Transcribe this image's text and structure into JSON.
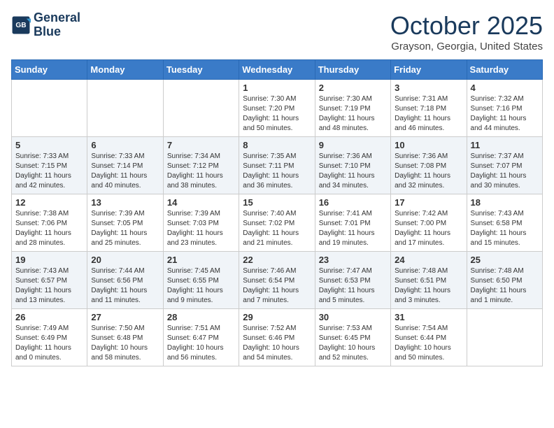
{
  "header": {
    "logo_line1": "General",
    "logo_line2": "Blue",
    "month": "October 2025",
    "location": "Grayson, Georgia, United States"
  },
  "weekdays": [
    "Sunday",
    "Monday",
    "Tuesday",
    "Wednesday",
    "Thursday",
    "Friday",
    "Saturday"
  ],
  "weeks": [
    [
      {
        "day": "",
        "info": ""
      },
      {
        "day": "",
        "info": ""
      },
      {
        "day": "",
        "info": ""
      },
      {
        "day": "1",
        "info": "Sunrise: 7:30 AM\nSunset: 7:20 PM\nDaylight: 11 hours\nand 50 minutes."
      },
      {
        "day": "2",
        "info": "Sunrise: 7:30 AM\nSunset: 7:19 PM\nDaylight: 11 hours\nand 48 minutes."
      },
      {
        "day": "3",
        "info": "Sunrise: 7:31 AM\nSunset: 7:18 PM\nDaylight: 11 hours\nand 46 minutes."
      },
      {
        "day": "4",
        "info": "Sunrise: 7:32 AM\nSunset: 7:16 PM\nDaylight: 11 hours\nand 44 minutes."
      }
    ],
    [
      {
        "day": "5",
        "info": "Sunrise: 7:33 AM\nSunset: 7:15 PM\nDaylight: 11 hours\nand 42 minutes."
      },
      {
        "day": "6",
        "info": "Sunrise: 7:33 AM\nSunset: 7:14 PM\nDaylight: 11 hours\nand 40 minutes."
      },
      {
        "day": "7",
        "info": "Sunrise: 7:34 AM\nSunset: 7:12 PM\nDaylight: 11 hours\nand 38 minutes."
      },
      {
        "day": "8",
        "info": "Sunrise: 7:35 AM\nSunset: 7:11 PM\nDaylight: 11 hours\nand 36 minutes."
      },
      {
        "day": "9",
        "info": "Sunrise: 7:36 AM\nSunset: 7:10 PM\nDaylight: 11 hours\nand 34 minutes."
      },
      {
        "day": "10",
        "info": "Sunrise: 7:36 AM\nSunset: 7:08 PM\nDaylight: 11 hours\nand 32 minutes."
      },
      {
        "day": "11",
        "info": "Sunrise: 7:37 AM\nSunset: 7:07 PM\nDaylight: 11 hours\nand 30 minutes."
      }
    ],
    [
      {
        "day": "12",
        "info": "Sunrise: 7:38 AM\nSunset: 7:06 PM\nDaylight: 11 hours\nand 28 minutes."
      },
      {
        "day": "13",
        "info": "Sunrise: 7:39 AM\nSunset: 7:05 PM\nDaylight: 11 hours\nand 25 minutes."
      },
      {
        "day": "14",
        "info": "Sunrise: 7:39 AM\nSunset: 7:03 PM\nDaylight: 11 hours\nand 23 minutes."
      },
      {
        "day": "15",
        "info": "Sunrise: 7:40 AM\nSunset: 7:02 PM\nDaylight: 11 hours\nand 21 minutes."
      },
      {
        "day": "16",
        "info": "Sunrise: 7:41 AM\nSunset: 7:01 PM\nDaylight: 11 hours\nand 19 minutes."
      },
      {
        "day": "17",
        "info": "Sunrise: 7:42 AM\nSunset: 7:00 PM\nDaylight: 11 hours\nand 17 minutes."
      },
      {
        "day": "18",
        "info": "Sunrise: 7:43 AM\nSunset: 6:58 PM\nDaylight: 11 hours\nand 15 minutes."
      }
    ],
    [
      {
        "day": "19",
        "info": "Sunrise: 7:43 AM\nSunset: 6:57 PM\nDaylight: 11 hours\nand 13 minutes."
      },
      {
        "day": "20",
        "info": "Sunrise: 7:44 AM\nSunset: 6:56 PM\nDaylight: 11 hours\nand 11 minutes."
      },
      {
        "day": "21",
        "info": "Sunrise: 7:45 AM\nSunset: 6:55 PM\nDaylight: 11 hours\nand 9 minutes."
      },
      {
        "day": "22",
        "info": "Sunrise: 7:46 AM\nSunset: 6:54 PM\nDaylight: 11 hours\nand 7 minutes."
      },
      {
        "day": "23",
        "info": "Sunrise: 7:47 AM\nSunset: 6:53 PM\nDaylight: 11 hours\nand 5 minutes."
      },
      {
        "day": "24",
        "info": "Sunrise: 7:48 AM\nSunset: 6:51 PM\nDaylight: 11 hours\nand 3 minutes."
      },
      {
        "day": "25",
        "info": "Sunrise: 7:48 AM\nSunset: 6:50 PM\nDaylight: 11 hours\nand 1 minute."
      }
    ],
    [
      {
        "day": "26",
        "info": "Sunrise: 7:49 AM\nSunset: 6:49 PM\nDaylight: 11 hours\nand 0 minutes."
      },
      {
        "day": "27",
        "info": "Sunrise: 7:50 AM\nSunset: 6:48 PM\nDaylight: 10 hours\nand 58 minutes."
      },
      {
        "day": "28",
        "info": "Sunrise: 7:51 AM\nSunset: 6:47 PM\nDaylight: 10 hours\nand 56 minutes."
      },
      {
        "day": "29",
        "info": "Sunrise: 7:52 AM\nSunset: 6:46 PM\nDaylight: 10 hours\nand 54 minutes."
      },
      {
        "day": "30",
        "info": "Sunrise: 7:53 AM\nSunset: 6:45 PM\nDaylight: 10 hours\nand 52 minutes."
      },
      {
        "day": "31",
        "info": "Sunrise: 7:54 AM\nSunset: 6:44 PM\nDaylight: 10 hours\nand 50 minutes."
      },
      {
        "day": "",
        "info": ""
      }
    ]
  ]
}
